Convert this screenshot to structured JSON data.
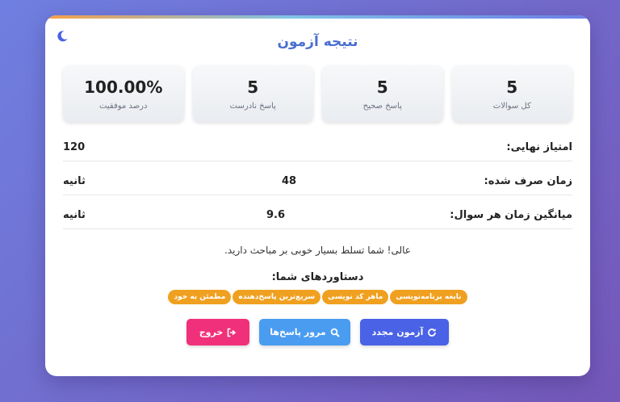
{
  "header": {
    "title": "نتیجه آزمون",
    "theme_icon": "moon-icon"
  },
  "stats": [
    {
      "value": "5",
      "label": "کل سوالات"
    },
    {
      "value": "5",
      "label": "پاسخ صحیح"
    },
    {
      "value": "5",
      "label": "پاسخ نادرست"
    },
    {
      "value": "100.00%",
      "label": "درصد موفقیت"
    }
  ],
  "details": {
    "final_score": {
      "label": "امتیاز نهایی:",
      "value": "120"
    },
    "time_spent": {
      "label": "زمان صرف شده:",
      "value": "48",
      "unit": "ثانیه"
    },
    "avg_time": {
      "label": "میانگین زمان هر سوال:",
      "value": "9.6",
      "unit": "ثانیه"
    }
  },
  "message": "عالی! شما تسلط بسیار خوبی بر مباحث دارید.",
  "achievements": {
    "title": "دستاوردهای شما:",
    "items": [
      "نابغه برنامه‌نویسی",
      "ماهر کد نویسی",
      "سریع‌ترین پاسخ‌دهنده",
      "مطمئن به خود"
    ]
  },
  "buttons": {
    "retry": "آزمون مجدد",
    "review": "مرور پاسخ‌ها",
    "exit": "خروج"
  },
  "colors": {
    "title": "#4a6fd0",
    "retry": "#4a62e6",
    "review": "#4a9cf0",
    "exit": "#f0307a",
    "badge": "#f0a020"
  }
}
